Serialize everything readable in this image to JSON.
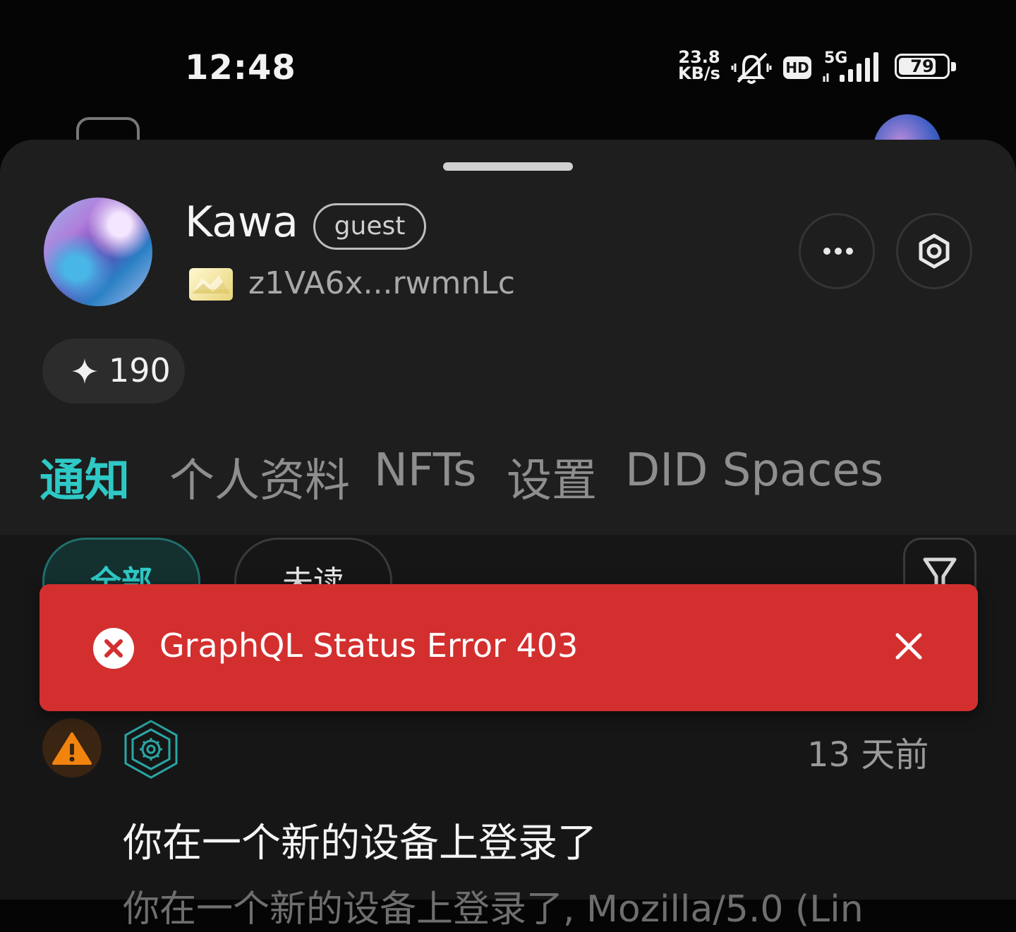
{
  "status_bar": {
    "time": "12:48",
    "net_speed_value": "23.8",
    "net_speed_unit": "KB/s",
    "hd_label": "HD",
    "network_label": "5G",
    "battery_level": "79",
    "icons": [
      "mute-icon",
      "signal-icon",
      "battery-icon"
    ]
  },
  "profile": {
    "name": "Kawa",
    "role": "guest",
    "did_short": "z1VA6x...rwmnLc",
    "points": "190",
    "points_icon": "sparkle-icon"
  },
  "tabs": [
    {
      "label": "通知",
      "active": true
    },
    {
      "label": "个人资料",
      "active": false
    },
    {
      "label": "NFTs",
      "active": false
    },
    {
      "label": "设置",
      "active": false
    },
    {
      "label": "DID Spaces",
      "active": false
    }
  ],
  "filters": {
    "all_label": "全部",
    "unread_label": "未读"
  },
  "toast": {
    "message": "GraphQL Status Error 403",
    "color": "#d32f2f"
  },
  "notification": {
    "time": "13 天前",
    "title": "你在一个新的设备上登录了",
    "body": "你在一个新的设备上登录了, Mozilla/5.0 (Lin"
  },
  "colors": {
    "accent": "#2ec9c6",
    "warning": "#f0840f",
    "error": "#d32f2f"
  }
}
